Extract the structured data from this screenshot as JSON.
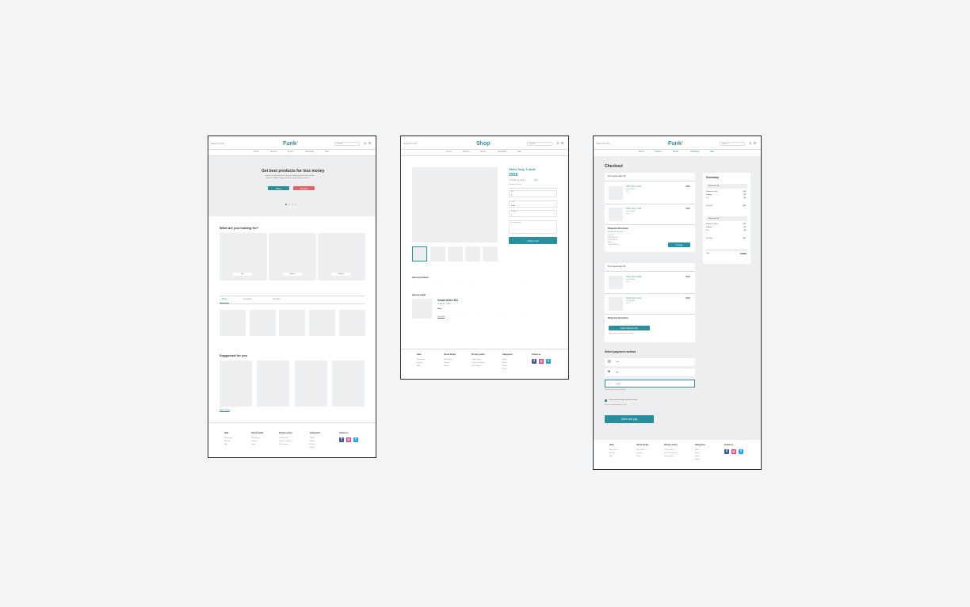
{
  "frame1": {
    "header": {
      "search_placeholder": "Search Funk",
      "logo": "Funk",
      "logo_mark": "⁄",
      "box_placeholder": "Search"
    },
    "nav": [
      "Home",
      "Women",
      "Sports",
      "Handbags",
      "Sale"
    ],
    "hero": {
      "title": "Get best products for less money",
      "text1": "Lorem ipsum dolor sit amet consectetur adipiscing elit sed do eiusmod",
      "text2": "tempor incididunt ut labore et dolore magna aliqua ut enim ad",
      "btn_primary": "Shop",
      "btn_secondary": "Contact"
    },
    "looking": {
      "title": "What are you looking for?",
      "cards": [
        "Men",
        "Women",
        "Children"
      ]
    },
    "tabs": [
      "Plays",
      "Consoles",
      "Services"
    ],
    "suggested": {
      "title": "Suggested for you",
      "see_more": "See more"
    },
    "footer": {
      "cols": [
        {
          "h": "Help",
          "items": [
            "Mail contact",
            "Returns",
            "FAQ"
          ]
        },
        {
          "h": "About Funky",
          "items": [
            "Work with us",
            "Contact",
            "Stores"
          ]
        },
        {
          "h": "Privacy policy",
          "items": [
            "Cookie policy",
            "Terms & conditions",
            "Refund policy"
          ]
        },
        {
          "h": "Categories",
          "items": [
            "Retail",
            "Rental",
            "Rental",
            "Rental"
          ]
        }
      ],
      "follow": "Follow us"
    }
  },
  "frame2": {
    "header": {
      "search_placeholder": "Search Funk",
      "logo": "Shop",
      "box_placeholder": "Search"
    },
    "nav": [
      "Home",
      "Women",
      "Sports",
      "Handbags",
      "Sale"
    ],
    "product": {
      "title": "Hello Tony T-shirt",
      "price": "255$",
      "rating_text": "4.8 (100) ★★★★☆",
      "rating_count": "(32)",
      "sku": "Delivery in 3 days",
      "select1": {
        "label": "Size",
        "value": "S"
      },
      "select2": {
        "label": "Color",
        "value": "White"
      },
      "select3": {
        "label": "Quantity",
        "value": "1"
      },
      "textarea": "Personalization",
      "add_button": "Add to cart"
    },
    "about": {
      "title": "About product",
      "text1": "Lorem ipsum dolor sit amet consectetur adipiscing elit sed do eiusmod tempor incididunt ut labore et dolore magna aliqua ut enim ad minim veniam quis nostrud exercitation ullamco laboris nisi ut aliquip ex ea commodo",
      "text2": "consequat duis aute irure dolor in reprehenderit in voluptate velit esse cillum dolore eu fugiat nulla pariatur excepteur sint occaecat"
    },
    "seller": {
      "title": "About seller",
      "name": "Good seller 231",
      "rating": "★★★★☆ (32)",
      "sub": "Shop",
      "text": "Lorem ipsum dolor sit amet consectetur adipiscing elit sed do eiusmod tempor incididunt ut labore et dolore magna aliqua ut enim ad minim veniam quis nostrud",
      "link": "Visit seller"
    },
    "footer": {
      "cols": [
        {
          "h": "Help",
          "items": [
            "Mail contact",
            "Returns",
            "FAQ"
          ]
        },
        {
          "h": "About Funky",
          "items": [
            "Work with us",
            "Contact",
            "Stores"
          ]
        },
        {
          "h": "Privacy policy",
          "items": [
            "Cookie policy",
            "Terms & conditions",
            "Refund policy"
          ]
        },
        {
          "h": "Categories",
          "items": [
            "Retail",
            "Rental",
            "Rental",
            "Rental"
          ]
        }
      ],
      "follow": "Follow us"
    }
  },
  "frame3": {
    "header": {
      "search_placeholder": "Search Funk",
      "logo": "Funk",
      "logo_mark": "⁄",
      "box_placeholder": "Search"
    },
    "nav": [
      "Home",
      "Women",
      "Sports",
      "Handbags",
      "Sale"
    ],
    "title": "Checkout",
    "seller1": {
      "label": "From good seller 46",
      "items": [
        {
          "name": "Hello Tony T-shirt",
          "price": "255$",
          "l1": "Size: M White",
          "l2": "Qty: 1"
        },
        {
          "name": "Hello Tony T-shirt",
          "price": "255$",
          "l1": "Size: M White",
          "l2": "Qty: 1"
        }
      ],
      "shipment": "Shipment information",
      "link": "Add address + discount",
      "lines": [
        "John Doe",
        "Main Street 123",
        "11-111 Warsaw",
        "Poland",
        "+48 000 000 000"
      ],
      "change": "Change"
    },
    "seller2": {
      "label": "From good seller 46",
      "items": [
        {
          "name": "Hello Tony T-shirt",
          "price": "255$",
          "l1": "Size: M White",
          "l2": "Qty: 1"
        },
        {
          "name": "Hello Tony T-shirt",
          "price": "255$",
          "l1": "Size: M White",
          "l2": "Qty: 1"
        }
      ],
      "shipment": "Shipment information",
      "btn": "Enter shipment info",
      "hint": "Please enter your shipment information"
    },
    "summary": {
      "title": "Summary",
      "g1": {
        "h": "Good seller 46",
        "rows": [
          [
            "Products (2 items)",
            "510$"
          ],
          [
            "Shipping",
            "10$"
          ],
          [
            "Tax",
            "20$"
          ]
        ],
        "total": [
          "Sum Total",
          "540$"
        ]
      },
      "g2": {
        "h": "Good seller 46",
        "rows": [
          [
            "Products (2 items)",
            "510$"
          ],
          [
            "Shipping",
            "10$"
          ],
          [
            "Tax",
            "20$"
          ]
        ],
        "total": [
          "Sum Total",
          "540$"
        ]
      },
      "grand": [
        "Total",
        "1080$"
      ]
    },
    "payment": {
      "title": "Select payment method",
      "options": [
        "Visa",
        "pay",
        "Card"
      ],
      "error": "Please select a payment method",
      "terms": "I have read and accept the terms of sale",
      "terms_error": "You must accept the terms of sale",
      "order": "Order and pay"
    },
    "footer": {
      "cols": [
        {
          "h": "Help",
          "items": [
            "Mail contact",
            "Returns",
            "FAQ"
          ]
        },
        {
          "h": "About Funky",
          "items": [
            "Work with us",
            "Contact",
            "Stores"
          ]
        },
        {
          "h": "Privacy policy",
          "items": [
            "Cookie policy",
            "Terms & conditions",
            "Refund policy"
          ]
        },
        {
          "h": "Categories",
          "items": [
            "Retail",
            "Rental",
            "Rental",
            "Rental"
          ]
        }
      ],
      "follow": "Follow us"
    }
  }
}
